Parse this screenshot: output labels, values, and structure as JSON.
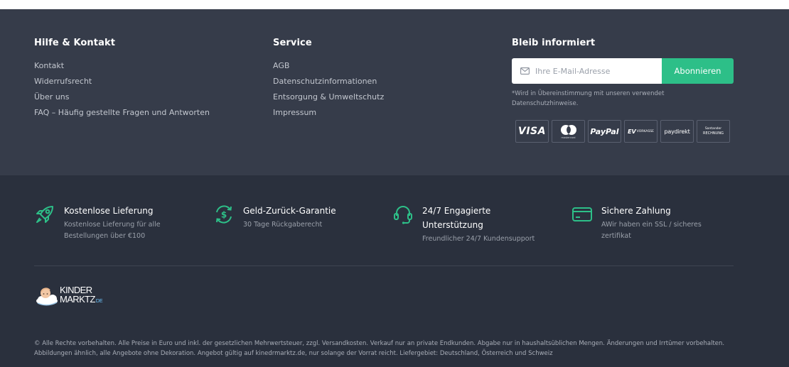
{
  "help": {
    "title": "Hilfe & Kontakt",
    "links": [
      "Kontakt",
      "Widerrufsrecht",
      "Über uns",
      "FAQ – Häufig gestellte Fragen und Antworten"
    ]
  },
  "service": {
    "title": "Service",
    "links": [
      "AGB",
      "Datenschutzinformationen",
      "Entsorgung & Umweltschutz",
      "Impressum"
    ]
  },
  "newsletter": {
    "title": "Bleib informiert",
    "placeholder": "Ihre E-Mail-Adresse",
    "button": "Abonnieren",
    "note": "*Wird in Übereinstimmung mit unseren verwendet Datenschutzhinweise."
  },
  "payments": {
    "visa": "VISA",
    "mastercard": "mastercard",
    "paypal": "PayPal",
    "vorkasse": "VORKASSE",
    "paydirekt": "paydirekt",
    "santander_top": "Santander",
    "santander_bottom": "RECHNUNG"
  },
  "features": [
    {
      "title": "Kostenlose Lieferung",
      "desc": "Kostenlose Lieferung für alle Bestellungen über €100",
      "icon": "rocket-icon"
    },
    {
      "title": "Geld-Zurück-Garantie",
      "desc": "30 Tage Rückgaberecht",
      "icon": "money-back-icon"
    },
    {
      "title": "24/7 Engagierte Unterstützung",
      "desc": "Freundlicher 24/7 Kundensupport",
      "icon": "headset-icon"
    },
    {
      "title": "Sichere Zahlung",
      "desc": "AWir haben ein SSL / sicheres zertifikat",
      "icon": "credit-card-icon"
    }
  ],
  "logo": {
    "line1": "KINDER",
    "line2": "MARKTZ",
    "suffix": "DE"
  },
  "copyright": "© Alle Rechte vorbehalten. Alle Preise in Euro und inkl. der gesetzlichen Mehrwertsteuer, zzgl. Versandkosten. Verkauf nur an private Endkunden. Abgabe nur in haushaltsüblichen Mengen. Änderungen und Irrtümer vorbehalten. Abbildungen ähnlich, alle Angebote ohne Dekoration. Angebot gültig auf kinedrmarktz.de, nur solange der Vorrat reicht. Liefergebiet: Deutschland, Österreich und Schweiz",
  "colors": {
    "accent": "#2dbf88",
    "footer_upper": "#363c4a",
    "footer_lower": "#2a303d"
  }
}
